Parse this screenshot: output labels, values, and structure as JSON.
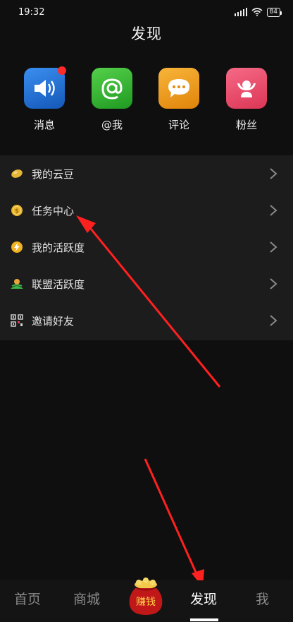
{
  "status": {
    "time": "19:32",
    "battery": "84"
  },
  "page": {
    "title": "发现"
  },
  "shortcuts": [
    {
      "icon": "speaker-icon",
      "label": "消息",
      "color": "#1e73d8",
      "badge": true
    },
    {
      "icon": "at-icon",
      "label": "@我",
      "color": "#2fb52e"
    },
    {
      "icon": "comment-icon",
      "label": "评论",
      "color": "#f29a14"
    },
    {
      "icon": "fans-icon",
      "label": "粉丝",
      "color": "#ec4f6c"
    }
  ],
  "menu": [
    {
      "icon": "bean-icon",
      "label": "我的云豆"
    },
    {
      "icon": "coin-icon",
      "label": "任务中心"
    },
    {
      "icon": "lightning-icon",
      "label": "我的活跃度"
    },
    {
      "icon": "alliance-icon",
      "label": "联盟活跃度"
    },
    {
      "icon": "qrcode-icon",
      "label": "邀请好友"
    }
  ],
  "tabbar": {
    "home": "首页",
    "mall": "商城",
    "center": "赚钱",
    "discover": "发现",
    "me": "我",
    "active": "发现"
  },
  "colors": {
    "accent_arrow": "#ff2020",
    "background": "#0f0f0f",
    "menu_bg": "#1c1c1c"
  }
}
